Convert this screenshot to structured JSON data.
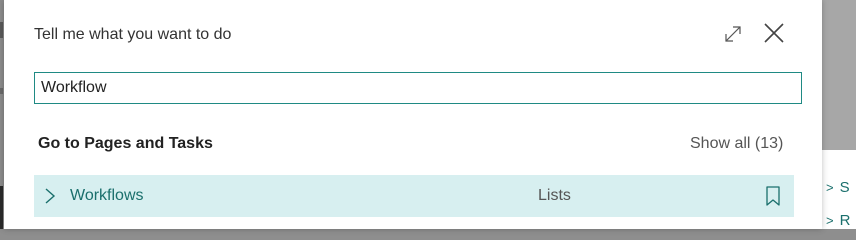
{
  "dialog": {
    "title": "Tell me what you want to do",
    "search": {
      "value": "Workflow",
      "placeholder": ""
    },
    "section": {
      "title": "Go to Pages and Tasks",
      "show_all": "Show all (13)"
    },
    "results": [
      {
        "name": "Workflows",
        "category": "Lists"
      }
    ],
    "icons": {
      "expand": "expand-icon",
      "close": "close-icon",
      "chevron": "chevron-right-icon",
      "bookmark": "bookmark-icon"
    },
    "colors": {
      "accent": "#1f8a84",
      "link": "#1a6f6c",
      "row_highlight": "#d7eff0"
    }
  },
  "background": {
    "items": [
      {
        "label": "S"
      },
      {
        "label": "R"
      }
    ]
  }
}
